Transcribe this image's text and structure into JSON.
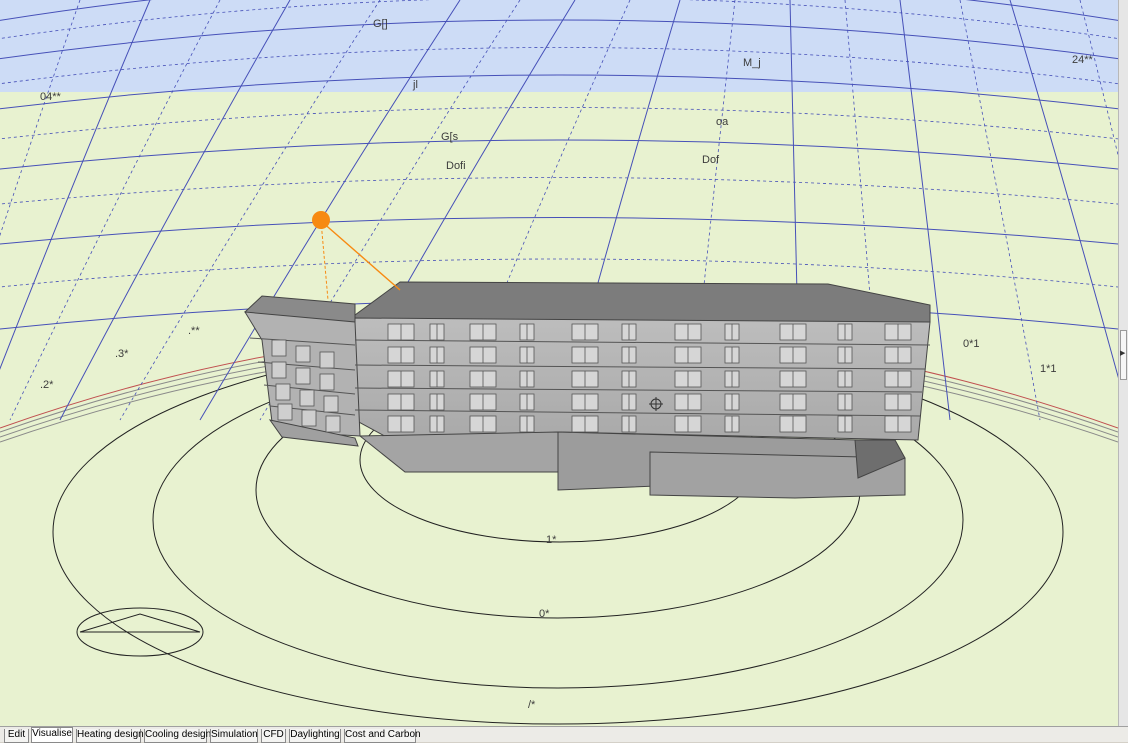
{
  "sky_labels": {
    "top": "G[]",
    "upper_left": "jl",
    "upper_right": "M_j",
    "mid_left": "G[s",
    "mid_left_2": "Dofi",
    "mid_right": "oa",
    "mid_right_2": "Dof",
    "left_edge": "04**",
    "right_edge": "24**"
  },
  "altitude_labels": {
    "left_1": ".**",
    "left_2": ".3*",
    "left_3": ".2*",
    "right_1": "0*1",
    "right_2": "1*1"
  },
  "ring_labels": {
    "inner": "1*",
    "middle": "0*",
    "outer": "/*"
  },
  "colors": {
    "sky": "#cddcf6",
    "ground": "#e8f2d0",
    "sun": "#f78a12",
    "grid": "#4650b8"
  },
  "tabs": [
    {
      "label": "Edit",
      "active": false
    },
    {
      "label": "Visualise",
      "active": true
    },
    {
      "label": "Heating design",
      "active": false
    },
    {
      "label": "Cooling design",
      "active": false
    },
    {
      "label": "Simulation",
      "active": false
    },
    {
      "label": "CFD",
      "active": false
    },
    {
      "label": "Daylighting",
      "active": false
    },
    {
      "label": "Cost and Carbon",
      "active": false
    }
  ]
}
